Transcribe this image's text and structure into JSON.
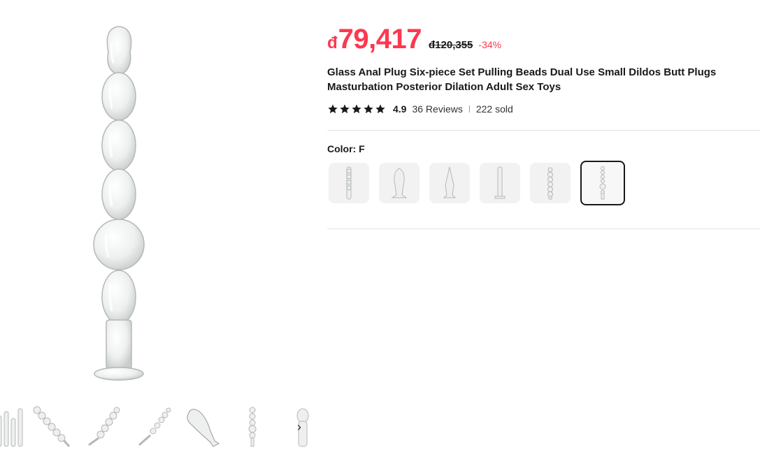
{
  "product": {
    "price_currency": "đ",
    "price_value": "79,417",
    "original_price": "đ120,355",
    "discount": "-34%",
    "title": "Glass Anal Plug Six-piece Set Pulling Beads Dual Use Small Dildos Butt Plugs Masturbation Posterior Dilation Adult Sex Toys",
    "rating": "4.9",
    "reviews": "36 Reviews",
    "sold": "222 sold",
    "color_label": "Color: F"
  },
  "colors": {
    "price": "#fd384f",
    "text": "#191919",
    "swatch_bg": "#f2f2f2",
    "divider": "#e5e5e5"
  },
  "icons": {
    "star": "star-icon",
    "next": "chevron-right-icon"
  },
  "gallery": {
    "next_glyph": "›"
  }
}
